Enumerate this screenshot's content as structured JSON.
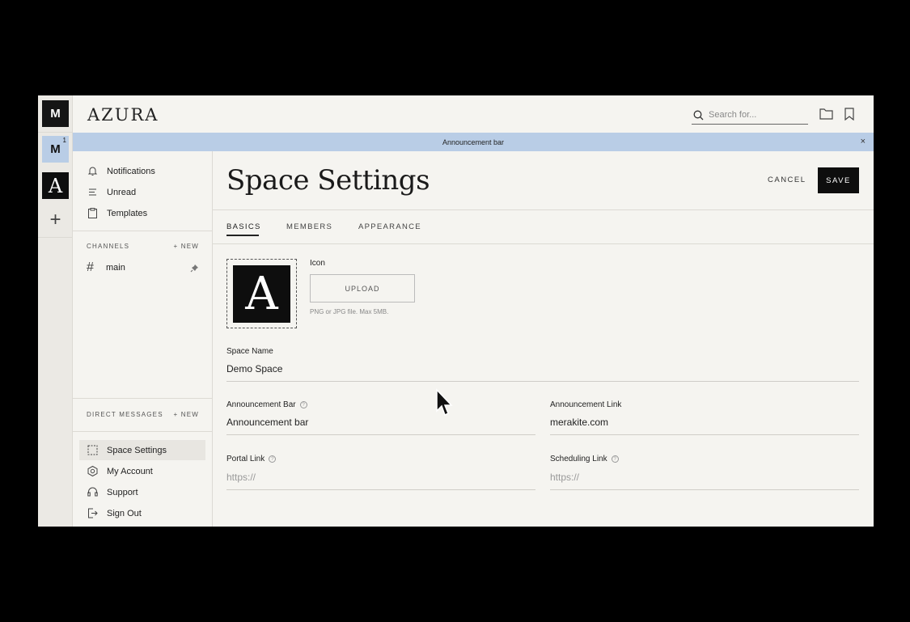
{
  "rail": {
    "m1": "M",
    "m2": "M",
    "m2_badge": "1",
    "a": "A",
    "add": "+"
  },
  "header": {
    "logo": "AZURA",
    "search_placeholder": "Search for..."
  },
  "announcement": {
    "text": "Announcement bar",
    "close": "×"
  },
  "sidebar": {
    "nav": [
      {
        "label": "Notifications",
        "icon": "bell-icon"
      },
      {
        "label": "Unread",
        "icon": "list-icon"
      },
      {
        "label": "Templates",
        "icon": "clipboard-icon"
      }
    ],
    "channels_title": "CHANNELS",
    "channels_new": "+ NEW",
    "channels": [
      {
        "label": "main",
        "icon": "hash-icon"
      }
    ],
    "dm_title": "DIRECT MESSAGES",
    "dm_new": "+ NEW",
    "bottom": [
      {
        "label": "Space Settings",
        "icon": "dashed-square-icon"
      },
      {
        "label": "My Account",
        "icon": "account-icon"
      },
      {
        "label": "Support",
        "icon": "headset-icon"
      },
      {
        "label": "Sign Out",
        "icon": "sign-out-icon"
      }
    ]
  },
  "main": {
    "title": "Space Settings",
    "cancel": "CANCEL",
    "save": "SAVE",
    "tabs": [
      "BASICS",
      "MEMBERS",
      "APPEARANCE"
    ],
    "icon_label": "Icon",
    "icon_letter": "A",
    "upload": "UPLOAD",
    "upload_hint": "PNG or JPG file. Max 5MB.",
    "space_name_label": "Space Name",
    "space_name_value": "Demo Space",
    "announcement_bar_label": "Announcement Bar",
    "announcement_bar_value": "Announcement bar",
    "announcement_link_label": "Announcement Link",
    "announcement_link_value": "merakite.com",
    "portal_link_label": "Portal Link",
    "portal_link_placeholder": "https://",
    "scheduling_link_label": "Scheduling Link",
    "scheduling_link_placeholder": "https://",
    "help_glyph": "?"
  },
  "colors": {
    "accent_blue": "#b9cde6",
    "background": "#f5f4f0",
    "dark": "#0e0e0e"
  }
}
